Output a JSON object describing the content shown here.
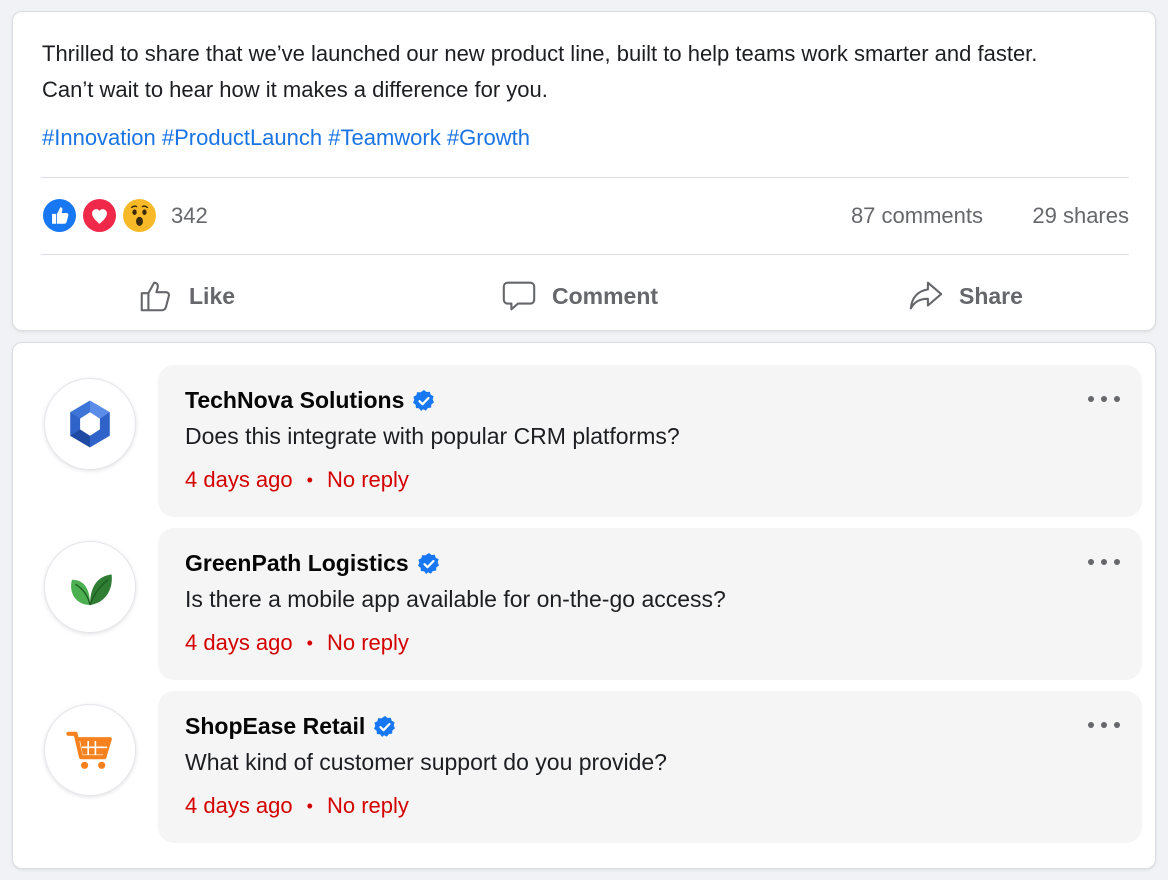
{
  "post": {
    "text_line1": "Thrilled to share that we’ve launched our new product line, built to help teams work smarter and faster.",
    "text_line2": "Can’t wait to hear how it makes a difference for you.",
    "hashtags": [
      "#Innovation",
      "#ProductLaunch",
      "#Teamwork",
      "#Growth"
    ],
    "reaction_count": "342",
    "comments_count": "87 comments",
    "shares_count": "29 shares",
    "actions": {
      "like": "Like",
      "comment": "Comment",
      "share": "Share"
    },
    "reactions": [
      "like-icon",
      "love-icon",
      "wow-icon"
    ]
  },
  "comments": [
    {
      "author": "TechNova Solutions",
      "text": "Does this integrate with popular CRM platforms?",
      "time": "4 days ago",
      "status": "No reply",
      "avatar_icon": "hexagon-logo-icon"
    },
    {
      "author": "GreenPath Logistics",
      "text": "Is there a mobile app available for on-the-go access?",
      "time": "4 days ago",
      "status": "No reply",
      "avatar_icon": "leaf-logo-icon"
    },
    {
      "author": "ShopEase Retail",
      "text": "What kind of customer support do you provide?",
      "time": "4 days ago",
      "status": "No reply",
      "avatar_icon": "cart-logo-icon"
    }
  ],
  "colors": {
    "hashtag": "#1b74e4",
    "meta_red": "#d40000",
    "verified": "#1877f2",
    "muted": "#65676b"
  }
}
